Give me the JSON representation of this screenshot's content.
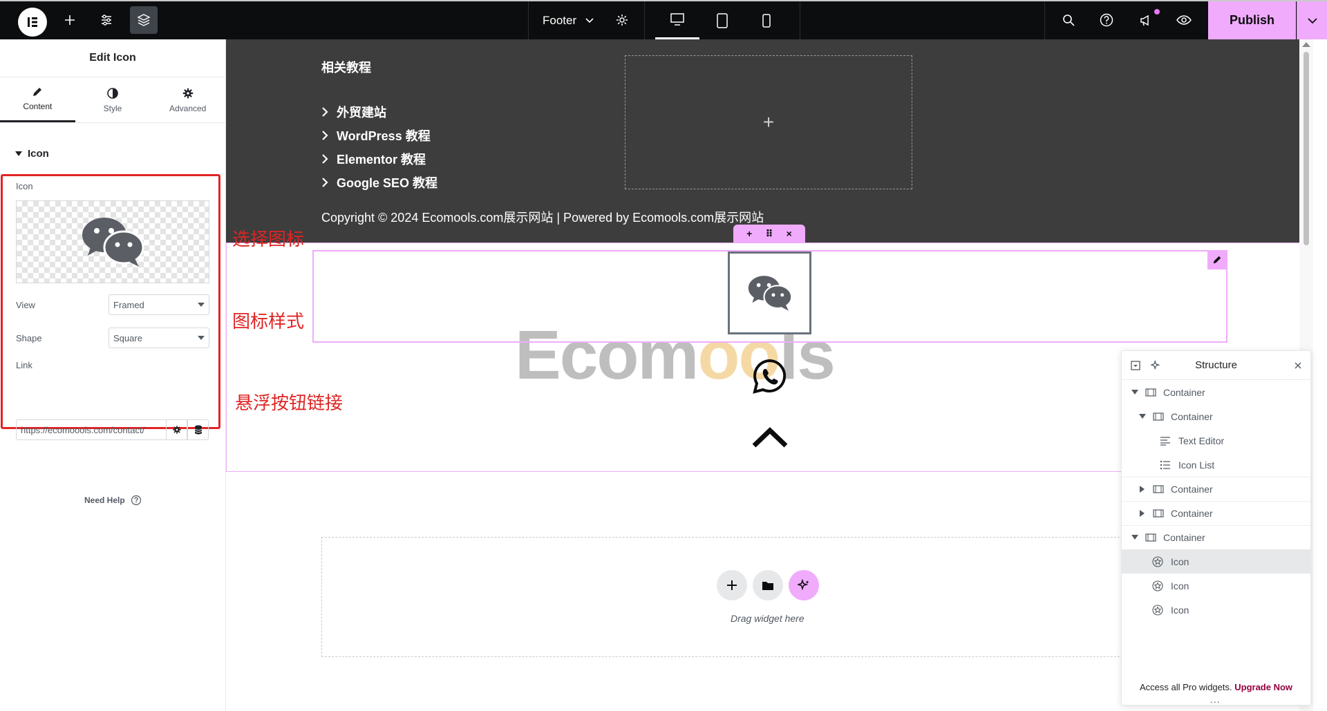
{
  "topbar": {
    "document": "Footer",
    "publish_label": "Publish",
    "icons": [
      "elementor-logo-icon",
      "plus-icon",
      "sliders-icon",
      "layers-icon",
      "chevron-down-icon",
      "gear-icon",
      "desktop-icon",
      "tablet-icon",
      "mobile-icon",
      "search-icon",
      "help-icon",
      "megaphone-icon",
      "eye-icon"
    ]
  },
  "panel": {
    "title": "Edit Icon",
    "tabs": [
      {
        "label": "Content",
        "icon": "pencil-icon",
        "active": true
      },
      {
        "label": "Style",
        "icon": "half-circle-icon",
        "active": false
      },
      {
        "label": "Advanced",
        "icon": "gear-icon",
        "active": false
      }
    ],
    "section": "Icon",
    "icon_label": "Icon",
    "preview_icon": "wechat-icon",
    "view": {
      "label": "View",
      "value": "Framed"
    },
    "shape": {
      "label": "Shape",
      "value": "Square"
    },
    "link": {
      "label": "Link",
      "value": "https://ecomoools.com/contact/"
    },
    "need_help": "Need Help"
  },
  "annotations": {
    "select_icon": "选择图标",
    "icon_style": "图标样式",
    "button_link": "悬浮按钮链接"
  },
  "canvas": {
    "footer_heading": "相关教程",
    "footer_links": [
      "外贸建站",
      "WordPress 教程",
      "Elementor 教程",
      "Google SEO 教程"
    ],
    "copyright": "Copyright © 2024 Ecomools.com展示网站 | Powered by Ecomools.com展示网站",
    "watermark_a": "Ec",
    "watermark_b": "om",
    "watermark_c": "oo",
    "watermark_d": "ls",
    "toolbar": {
      "add": "+",
      "drag": "⠿",
      "close": "×"
    },
    "drop_text": "Drag widget here",
    "placeholder_plus": "+"
  },
  "structure": {
    "title": "Structure",
    "rows": [
      {
        "label": "Container",
        "type": "container",
        "toggle": "down"
      },
      {
        "label": "Container",
        "type": "container",
        "toggle": "down"
      },
      {
        "label": "Text Editor",
        "type": "text-editor"
      },
      {
        "label": "Icon List",
        "type": "icon-list"
      },
      {
        "label": "Container",
        "type": "container",
        "toggle": "right"
      },
      {
        "label": "Container",
        "type": "container",
        "toggle": "right"
      },
      {
        "label": "Container",
        "type": "container",
        "toggle": "down"
      },
      {
        "label": "Icon",
        "type": "icon",
        "selected": true
      },
      {
        "label": "Icon",
        "type": "icon"
      },
      {
        "label": "Icon",
        "type": "icon"
      }
    ],
    "footer_text": "Access all Pro widgets.",
    "upgrade_label": "Upgrade Now",
    "grip": "..."
  },
  "colors": {
    "accent": "#f0abfc",
    "topbar": "#0c0d0e",
    "footer_bg": "#3d3d3d",
    "annotation_red": "#e02424"
  }
}
